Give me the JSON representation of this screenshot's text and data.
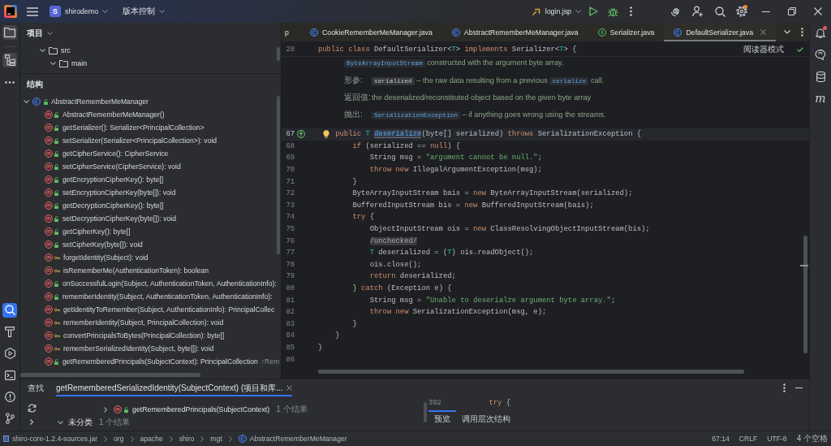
{
  "title_bar": {
    "project_initial": "S",
    "project_name": "shirodemo",
    "vcs_menu": "版本控制",
    "run_config": "login.jsp",
    "settings_badge": true
  },
  "left_toolbar": {
    "top": [
      {
        "kind": "project",
        "selected": true
      },
      {
        "kind": "structure",
        "selected": true
      },
      {
        "kind": "more",
        "selected": false
      }
    ],
    "bottom": [
      {
        "kind": "find",
        "selected": true
      },
      {
        "kind": "build",
        "selected": false
      },
      {
        "kind": "services",
        "selected": false
      },
      {
        "kind": "terminal",
        "selected": false
      },
      {
        "kind": "problems",
        "selected": false
      },
      {
        "kind": "git",
        "selected": false
      }
    ]
  },
  "project_panel": {
    "title": "项目",
    "tree": [
      {
        "label": "src",
        "expanded": true,
        "children": [
          {
            "label": "main",
            "expanded": true
          }
        ]
      }
    ]
  },
  "structure_panel": {
    "title": "结构",
    "tree": [
      {
        "label": "AbstractRememberMeManager",
        "kind": "class",
        "protected": false,
        "expanded": true,
        "children": [
          {
            "label": "AbstractRememberMeManager()",
            "kind": "method",
            "protected": false
          },
          {
            "label": "getSerializer(): Serializer<PrincipalCollection>",
            "kind": "method",
            "protected": false
          },
          {
            "label": "setSerializer(Serializer<PrincipalCollection>): void",
            "kind": "method",
            "protected": false
          },
          {
            "label": "getCipherService(): CipherService",
            "kind": "method",
            "protected": false
          },
          {
            "label": "setCipherService(CipherService): void",
            "kind": "method",
            "protected": false
          },
          {
            "label": "getEncryptionCipherKey(): byte[]",
            "kind": "method",
            "protected": false
          },
          {
            "label": "setEncryptionCipherKey(byte[]): void",
            "kind": "method",
            "protected": false
          },
          {
            "label": "getDecryptionCipherKey(): byte[]",
            "kind": "method",
            "protected": false
          },
          {
            "label": "setDecryptionCipherKey(byte[]): void",
            "kind": "method",
            "protected": false
          },
          {
            "label": "getCipherKey(): byte[]",
            "kind": "method",
            "protected": false
          },
          {
            "label": "setCipherKey(byte[]): void",
            "kind": "method",
            "protected": false
          },
          {
            "label": "forgetIdentity(Subject): void",
            "kind": "method",
            "protected": true
          },
          {
            "label": "isRememberMe(AuthenticationToken): boolean",
            "kind": "method",
            "protected": true
          },
          {
            "label": "onSuccessfulLogin(Subject, AuthenticationToken, AuthenticationInfo):",
            "kind": "method",
            "protected": false
          },
          {
            "label": "rememberIdentity(Subject, AuthenticationToken, AuthenticationInfo):",
            "kind": "method",
            "protected": false
          },
          {
            "label": "getIdentityToRemember(Subject, AuthenticationInfo): PrincipalCollec",
            "kind": "method",
            "protected": true
          },
          {
            "label": "rememberIdentity(Subject, PrincipalCollection): void",
            "kind": "method",
            "protected": true
          },
          {
            "label": "convertPrincipalsToBytes(PrincipalCollection): byte[]",
            "kind": "method",
            "protected": true
          },
          {
            "label": "rememberSerializedIdentity(Subject, byte[]): void",
            "kind": "method",
            "protected": true
          },
          {
            "label": "getRememberedPrincipals(SubjectContext): PrincipalCollection",
            "kind": "method",
            "protected": false,
            "hint": "↑Rem"
          }
        ]
      }
    ]
  },
  "editor": {
    "tabs": [
      {
        "label": "p",
        "kind": "none",
        "selected": false
      },
      {
        "label": "CookieRememberMeManager.java",
        "kind": "class",
        "selected": false
      },
      {
        "label": "AbstractRememberMeManager.java",
        "kind": "class",
        "selected": false
      },
      {
        "label": "Serializer.java",
        "kind": "interface",
        "selected": false
      },
      {
        "label": "DefaultSerializer.java",
        "kind": "class",
        "selected": true
      }
    ],
    "sticky_line": {
      "number": "28",
      "tokens": [
        {
          "kind": "keyword",
          "text": "public class "
        },
        {
          "kind": "plain",
          "text": "DefaultSerializer<"
        },
        {
          "kind": "type_param",
          "text": "T"
        },
        {
          "kind": "plain",
          "text": "> "
        },
        {
          "kind": "keyword",
          "text": "implements "
        },
        {
          "kind": "plain",
          "text": "Serializer<"
        },
        {
          "kind": "type_param",
          "text": "T"
        },
        {
          "kind": "plain",
          "text": "> {"
        }
      ]
    },
    "reader_mode": "阅读器模式",
    "doc": [
      {
        "parts": [
          {
            "kind": "link",
            "text": "ByteArrayInputStream"
          },
          {
            "kind": "text",
            "text": " constructed with the argument byte array."
          }
        ]
      },
      {
        "label": "形参:",
        "parts": [
          {
            "kind": "code",
            "text": "serialized"
          },
          {
            "kind": "text",
            "text": " – the raw data resulting from a previous "
          },
          {
            "kind": "link",
            "text": "serialize"
          },
          {
            "kind": "text",
            "text": " call."
          }
        ]
      },
      {
        "label": "返回值:",
        "parts": [
          {
            "kind": "text",
            "text": "the deserialized/reconstituted object based on the given byte array"
          }
        ]
      },
      {
        "label": "抛出:",
        "parts": [
          {
            "kind": "link",
            "text": "SerializationException"
          },
          {
            "kind": "text",
            "text": " – if anything goes wrong using the streams."
          }
        ]
      }
    ],
    "lines": [
      {
        "number": "67",
        "current": true,
        "implements_marker": true,
        "bulb": true,
        "tokens": [
          {
            "kind": "keyword",
            "text": "    public "
          },
          {
            "kind": "type_param",
            "text": "T "
          },
          {
            "kind": "declaration_at_caret",
            "text": "deserialize"
          },
          {
            "kind": "plain",
            "text": "(byte[] serialized) "
          },
          {
            "kind": "keyword",
            "text": "throws "
          },
          {
            "kind": "plain",
            "text": "SerializationException {"
          }
        ]
      },
      {
        "number": "68",
        "tokens": [
          {
            "kind": "keyword",
            "text": "        if"
          },
          {
            "kind": "plain",
            "text": " (serialized == "
          },
          {
            "kind": "keyword",
            "text": "null"
          },
          {
            "kind": "plain",
            "text": ") {"
          }
        ]
      },
      {
        "number": "69",
        "tokens": [
          {
            "kind": "plain",
            "text": "            String msg = "
          },
          {
            "kind": "string",
            "text": "\"argument cannot be null.\""
          },
          {
            "kind": "plain",
            "text": ";"
          }
        ]
      },
      {
        "number": "70",
        "tokens": [
          {
            "kind": "keyword",
            "text": "            throw new "
          },
          {
            "kind": "plain",
            "text": "IllegalArgumentException(msg);"
          }
        ]
      },
      {
        "number": "71",
        "tokens": [
          {
            "kind": "plain",
            "text": "        }"
          }
        ]
      },
      {
        "number": "72",
        "tokens": [
          {
            "kind": "plain",
            "text": "        ByteArrayInputStream bais = "
          },
          {
            "kind": "keyword",
            "text": "new "
          },
          {
            "kind": "plain",
            "text": "ByteArrayInputStream(serialized);"
          }
        ]
      },
      {
        "number": "73",
        "tokens": [
          {
            "kind": "plain",
            "text": "        BufferedInputStream bis = "
          },
          {
            "kind": "keyword",
            "text": "new "
          },
          {
            "kind": "plain",
            "text": "BufferedInputStream(bais);"
          }
        ]
      },
      {
        "number": "74",
        "tokens": [
          {
            "kind": "keyword",
            "text": "        try"
          },
          {
            "kind": "plain",
            "text": " {"
          }
        ]
      },
      {
        "number": "75",
        "tokens": [
          {
            "kind": "plain",
            "text": "            ObjectInputStream ois = "
          },
          {
            "kind": "keyword",
            "text": "new "
          },
          {
            "kind": "plain",
            "text": "ClassResolvingObjectInputStream(bis);"
          }
        ]
      },
      {
        "number": "76",
        "tokens": [
          {
            "kind": "comment",
            "text": "            /unchecked/"
          }
        ]
      },
      {
        "number": "77",
        "tokens": [
          {
            "kind": "type_param",
            "text": "            T"
          },
          {
            "kind": "plain",
            "text": " deserialized = ("
          },
          {
            "kind": "type_param",
            "text": "T"
          },
          {
            "kind": "plain",
            "text": ") ois.readObject();"
          }
        ]
      },
      {
        "number": "78",
        "tokens": [
          {
            "kind": "plain",
            "text": "            ois.close();"
          }
        ]
      },
      {
        "number": "79",
        "tokens": [
          {
            "kind": "keyword",
            "text": "            return"
          },
          {
            "kind": "plain",
            "text": " deserialized;"
          }
        ]
      },
      {
        "number": "80",
        "tokens": [
          {
            "kind": "plain",
            "text": "        } "
          },
          {
            "kind": "keyword",
            "text": "catch"
          },
          {
            "kind": "plain",
            "text": " (Exception e) {"
          }
        ]
      },
      {
        "number": "81",
        "tokens": [
          {
            "kind": "plain",
            "text": "            String msg = "
          },
          {
            "kind": "string",
            "text": "\"Unable to deserialze argument byte array.\""
          },
          {
            "kind": "plain",
            "text": ";"
          }
        ]
      },
      {
        "number": "82",
        "tokens": [
          {
            "kind": "keyword",
            "text": "            throw new"
          },
          {
            "kind": "plain",
            "text": " SerializationException(msg, e);"
          }
        ]
      },
      {
        "number": "83",
        "tokens": [
          {
            "kind": "plain",
            "text": "        }"
          }
        ]
      },
      {
        "number": "84",
        "tokens": [
          {
            "kind": "plain",
            "text": "    }"
          }
        ]
      },
      {
        "number": "85",
        "tokens": [
          {
            "kind": "plain",
            "text": "}"
          }
        ]
      },
      {
        "number": "86"
      }
    ]
  },
  "right_toolbar": [
    {
      "kind": "notifications",
      "badge": true
    },
    {
      "kind": "ai_chat"
    },
    {
      "kind": "database"
    },
    {
      "kind": "letter",
      "glyph": "m"
    }
  ],
  "find_panel": {
    "title": "查找",
    "tabs": [
      {
        "label": "getRememberedSerializedIdentity(SubjectContext) (项目和库...",
        "selected": true
      }
    ],
    "results": [
      {
        "kind": "usage",
        "label": "getRememberedPrincipals(SubjectContext)",
        "protected": false,
        "count": "1 个结果",
        "expanded": false
      },
      {
        "kind": "group",
        "label": "未分类",
        "count": "1 个结果",
        "expanded": true
      }
    ],
    "preview": {
      "line_number": "392",
      "tokens": [
        {
          "kind": "keyword",
          "text": "        try"
        },
        {
          "kind": "plain",
          "text": " {"
        }
      ]
    },
    "preview_tabs": [
      {
        "label": "预览",
        "selected": true
      },
      {
        "label": "调用层次结构",
        "selected": false
      }
    ]
  },
  "status_bar": {
    "breadcrumbs": [
      {
        "label": "shiro-core-1.2.4-sources.jar",
        "kind": "jar"
      },
      {
        "label": "org",
        "kind": "package"
      },
      {
        "label": "apache",
        "kind": "package"
      },
      {
        "label": "shiro",
        "kind": "package"
      },
      {
        "label": "mgt",
        "kind": "package"
      },
      {
        "label": "AbstractRememberMeManager",
        "kind": "class"
      }
    ],
    "caret_position": "67:14",
    "line_separator": "CRLF",
    "encoding": "UTF-8",
    "indent": "4 个空格"
  }
}
